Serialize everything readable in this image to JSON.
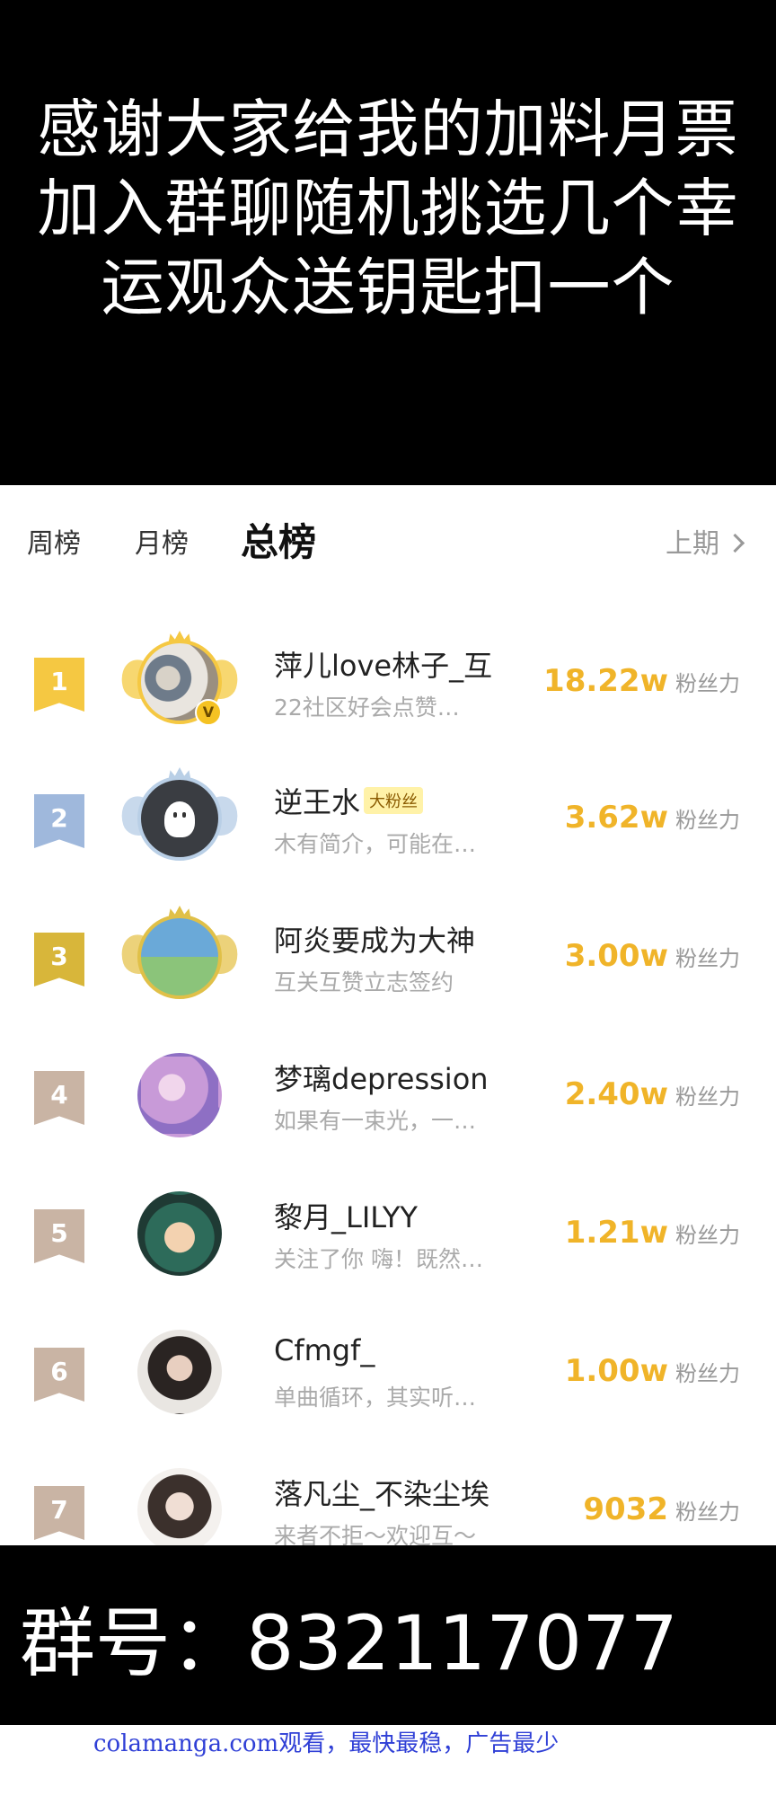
{
  "banner": {
    "lines": [
      "感谢大家给我的加料月票",
      "加入群聊随机挑选几个幸",
      "运观众送钥匙扣一个"
    ]
  },
  "tabs": {
    "week": "周榜",
    "month": "月榜",
    "total": "总榜",
    "previous": "上期"
  },
  "ranking": [
    {
      "rank": "1",
      "name": "萍儿love林子_互",
      "tag": "",
      "bio": "22社区好会点赞…",
      "score": "18.22w",
      "unit": "粉丝力",
      "badge_color": "#f5c842",
      "frame": "gold",
      "vip": "V"
    },
    {
      "rank": "2",
      "name": "逆王水",
      "tag": "大粉丝",
      "bio": "木有简介，可能在…",
      "score": "3.62w",
      "unit": "粉丝力",
      "badge_color": "#9fb8dc",
      "frame": "silver",
      "vip": ""
    },
    {
      "rank": "3",
      "name": "阿炎要成为大神",
      "tag": "",
      "bio": "互关互赞立志签约",
      "score": "3.00w",
      "unit": "粉丝力",
      "badge_color": "#d8b63a",
      "frame": "bronze",
      "vip": ""
    },
    {
      "rank": "4",
      "name": "梦璃depression",
      "tag": "",
      "bio": "如果有一束光，一…",
      "score": "2.40w",
      "unit": "粉丝力",
      "badge_color": "#c9b4a4",
      "frame": "none",
      "vip": ""
    },
    {
      "rank": "5",
      "name": "黎月_LILYY",
      "tag": "",
      "bio": "关注了你 嗨！既然…",
      "score": "1.21w",
      "unit": "粉丝力",
      "badge_color": "#c9b4a4",
      "frame": "none",
      "vip": ""
    },
    {
      "rank": "6",
      "name": "Cfmgf_",
      "tag": "",
      "bio": "单曲循环，其实听…",
      "score": "1.00w",
      "unit": "粉丝力",
      "badge_color": "#c9b4a4",
      "frame": "none",
      "vip": ""
    },
    {
      "rank": "7",
      "name": "落凡尘_不染尘埃",
      "tag": "",
      "bio": "来者不拒～欢迎互～",
      "score": "9032",
      "unit": "粉丝力",
      "badge_color": "#c9b4a4",
      "frame": "none",
      "vip": ""
    }
  ],
  "group": {
    "text": "群号：832117077"
  },
  "watermark": "colamanga.com观看，最快最稳，广告最少",
  "colors": {
    "score": "#f0b429",
    "gold_frame": "#f5c842",
    "silver_frame": "#b9cfe6",
    "bronze_frame": "#e0c048",
    "watermark": "#2f3fd6"
  }
}
